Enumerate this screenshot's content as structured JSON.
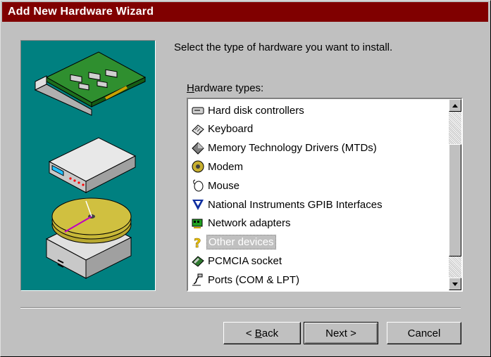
{
  "window": {
    "title": "Add New Hardware Wizard"
  },
  "prompt": "Select the type of hardware you want to install.",
  "hardware_types": {
    "label": "Hardware types:",
    "items": [
      {
        "label": "Hard disk controllers",
        "icon": "hard-disk-controller-icon"
      },
      {
        "label": "Keyboard",
        "icon": "keyboard-icon"
      },
      {
        "label": "Memory Technology Drivers (MTDs)",
        "icon": "memory-diamond-icon"
      },
      {
        "label": "Modem",
        "icon": "modem-icon"
      },
      {
        "label": "Mouse",
        "icon": "mouse-icon"
      },
      {
        "label": "National Instruments GPIB Interfaces",
        "icon": "gpib-icon"
      },
      {
        "label": "Network adapters",
        "icon": "network-adapter-icon"
      },
      {
        "label": "Other devices",
        "icon": "question-mark-icon",
        "selected": true
      },
      {
        "label": "PCMCIA socket",
        "icon": "pcmcia-icon"
      },
      {
        "label": "Ports (COM & LPT)",
        "icon": "port-icon"
      }
    ]
  },
  "buttons": {
    "back": "< Back",
    "next": "Next >",
    "cancel": "Cancel"
  },
  "colors": {
    "titlebar": "#800000",
    "panel": "#008080",
    "face": "#c0c0c0"
  }
}
